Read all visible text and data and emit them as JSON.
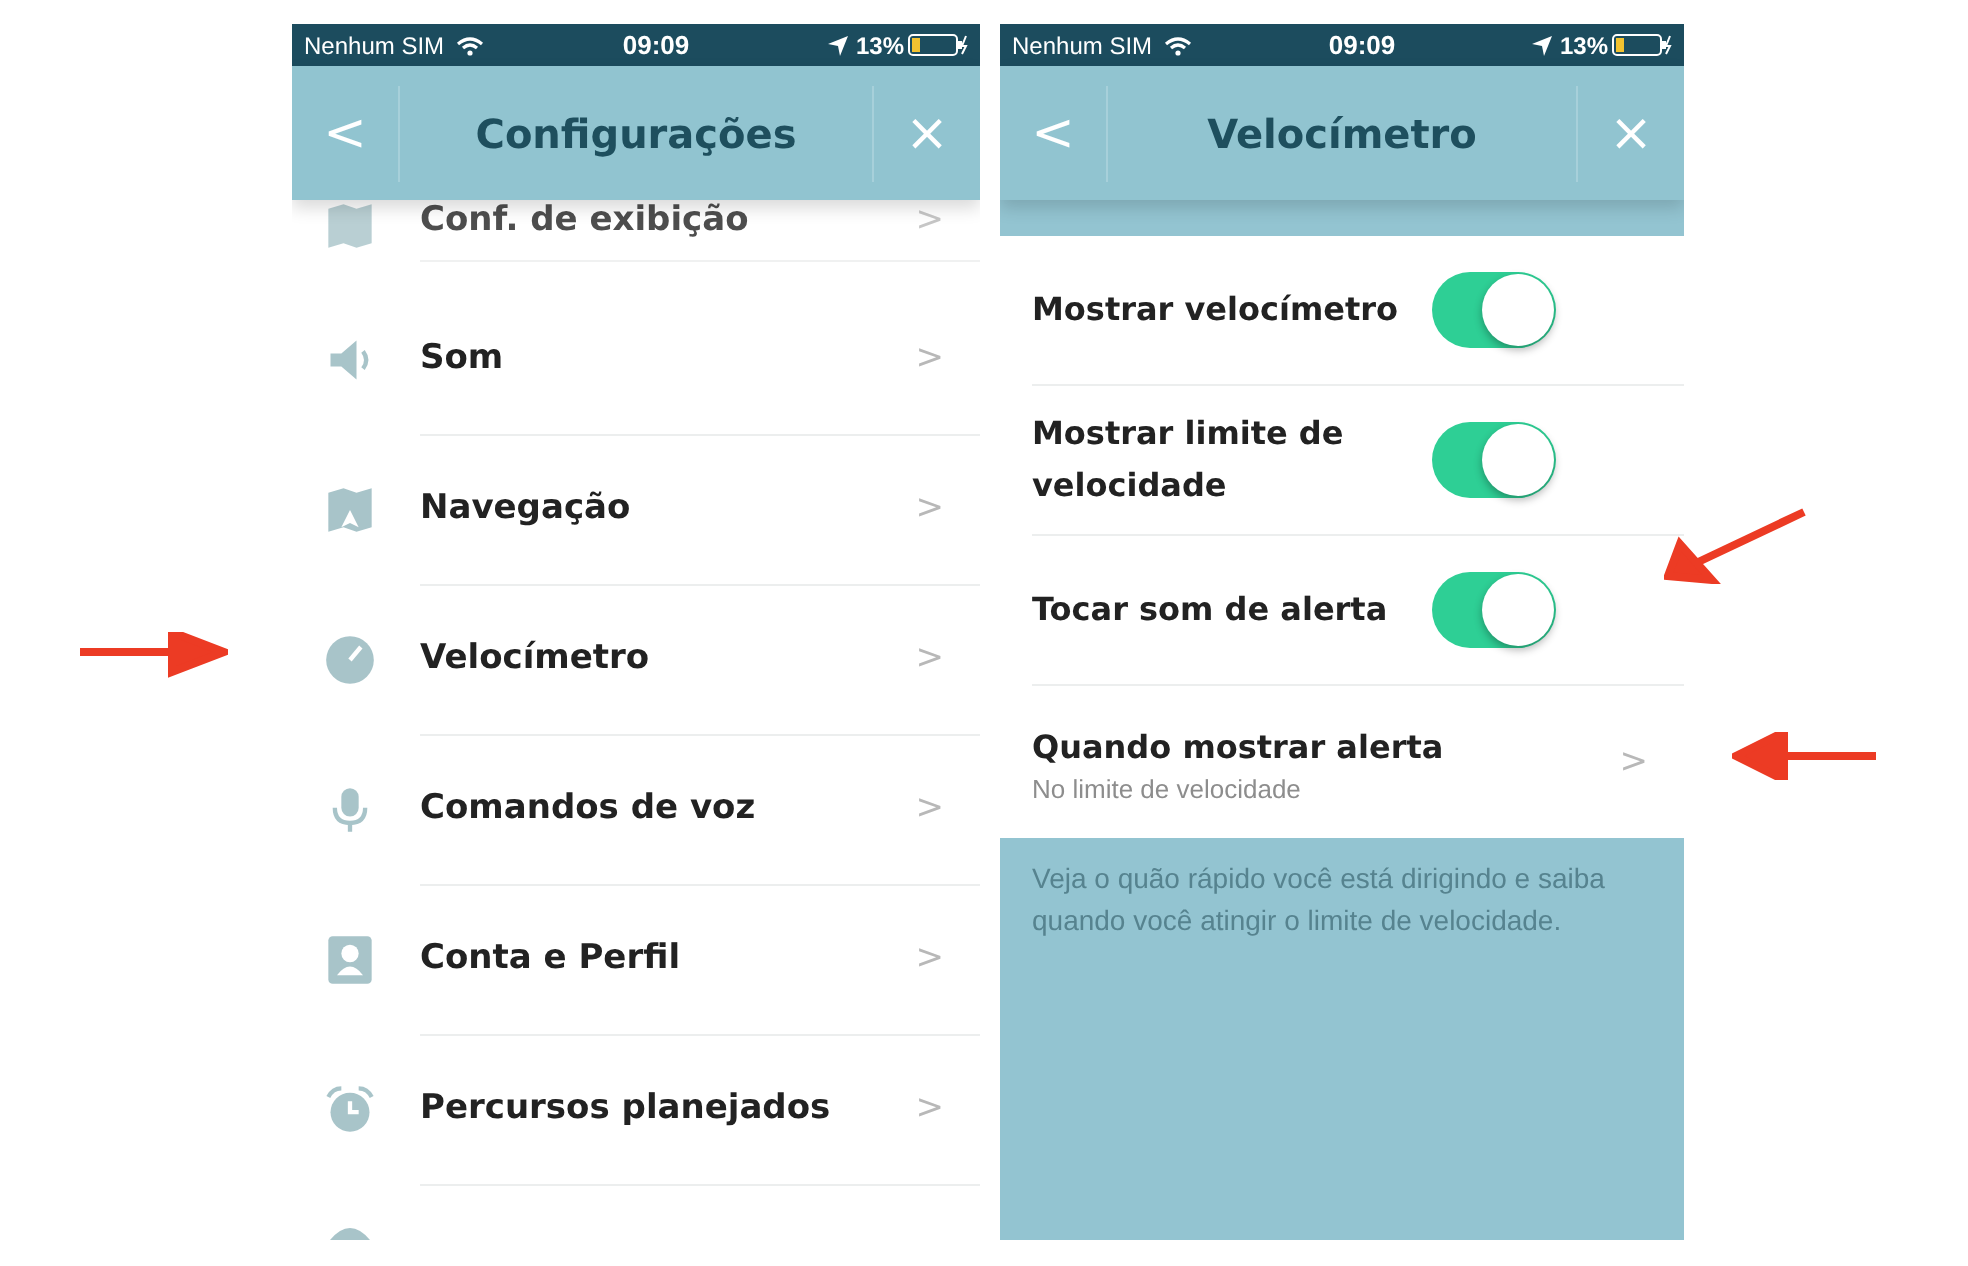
{
  "screens": [
    {
      "status_bar": {
        "carrier": "Nenhum SIM",
        "time": "09:09",
        "battery": "13%"
      },
      "nav": {
        "back": "<",
        "title": "Configurações",
        "close": "×"
      },
      "items": [
        {
          "label": "Conf. de exibição",
          "chevron": ">"
        },
        {
          "label": "Som",
          "chevron": ">"
        },
        {
          "label": "Navegação",
          "chevron": ">"
        },
        {
          "label": "Velocímetro",
          "chevron": ">"
        },
        {
          "label": "Comandos de voz",
          "chevron": ">"
        },
        {
          "label": "Conta e Perfil",
          "chevron": ">"
        },
        {
          "label": "Percursos planejados",
          "chevron": ">"
        }
      ]
    },
    {
      "status_bar": {
        "carrier": "Nenhum SIM",
        "time": "09:09",
        "battery": "13%"
      },
      "nav": {
        "back": "<",
        "title": "Velocímetro",
        "close": "×"
      },
      "settings": [
        {
          "kind": "toggle",
          "label": "Mostrar velocímetro",
          "on": true
        },
        {
          "kind": "toggle",
          "label": "Mostrar limite de velocidade",
          "on": true
        },
        {
          "kind": "toggle",
          "label": "Tocar som de alerta",
          "on": true
        },
        {
          "kind": "link",
          "label": "Quando mostrar alerta",
          "value": "No limite de velocidade",
          "chevron": ">"
        }
      ],
      "description": "Veja o quão rápido você está dirigindo e saiba quando você atingir o limite de velocidade."
    }
  ]
}
